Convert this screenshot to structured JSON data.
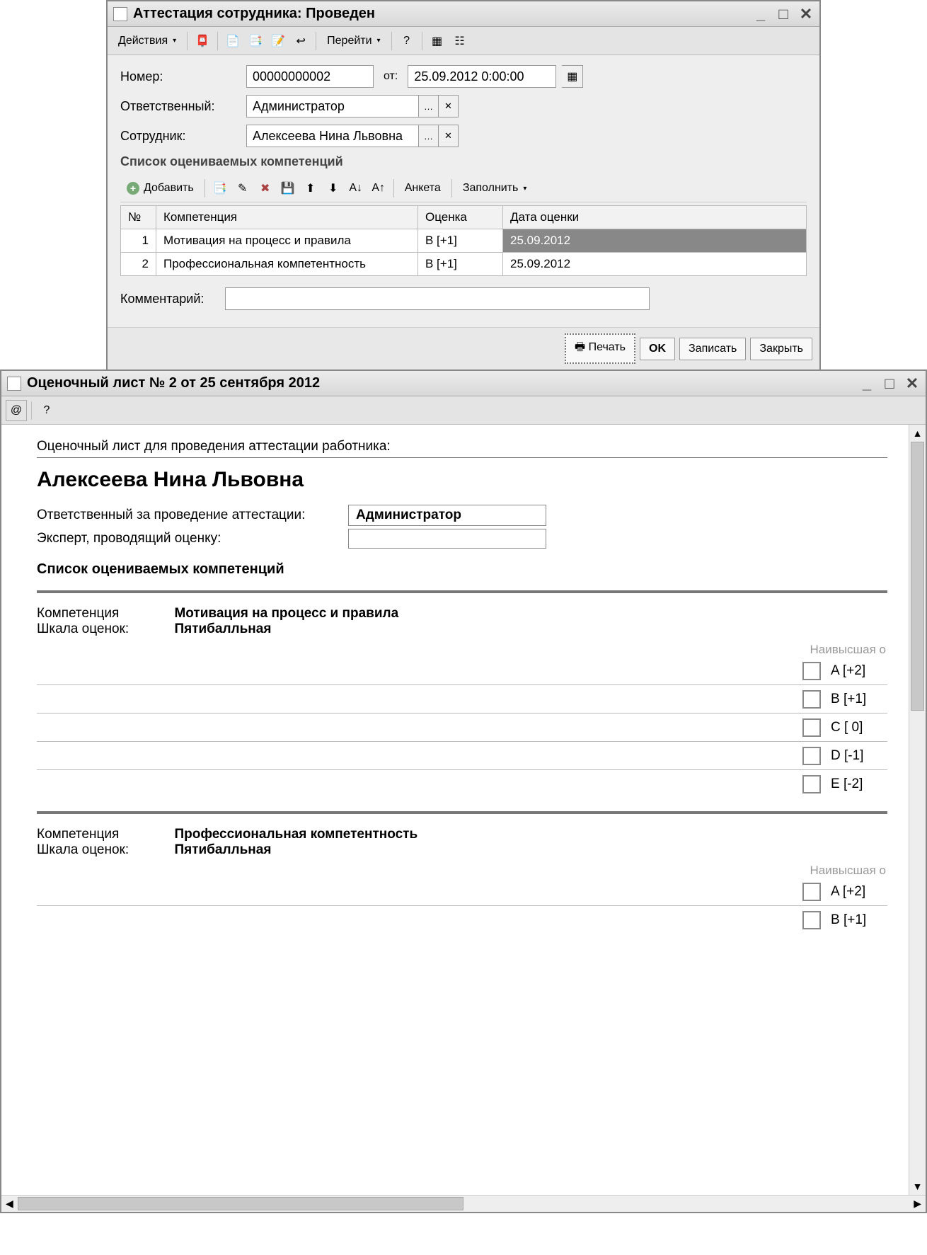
{
  "window1": {
    "title": "Аттестация сотрудника: Проведен",
    "toolbar": {
      "actions": "Действия",
      "goto": "Перейти"
    },
    "fields": {
      "number_label": "Номер:",
      "number_value": "00000000002",
      "from_label": "от:",
      "date_value": "25.09.2012  0:00:00",
      "responsible_label": "Ответственный:",
      "responsible_value": "Администратор",
      "employee_label": "Сотрудник:",
      "employee_value": "Алексеева Нина Львовна",
      "comment_label": "Комментарий:",
      "comment_value": ""
    },
    "competencies": {
      "section": "Список оцениваемых компетенций",
      "add": "Добавить",
      "anketa": "Анкета",
      "fill": "Заполнить",
      "columns": {
        "num": "№",
        "comp": "Компетенция",
        "grade": "Оценка",
        "date": "Дата оценки"
      },
      "rows": [
        {
          "n": "1",
          "comp": "Мотивация на процесс и правила",
          "grade": "B [+1]",
          "date": "25.09.2012"
        },
        {
          "n": "2",
          "comp": "Профессиональная компетентность",
          "grade": "B [+1]",
          "date": "25.09.2012"
        }
      ]
    },
    "footer": {
      "print": "Печать",
      "ok": "OK",
      "save": "Записать",
      "close": "Закрыть"
    }
  },
  "window2": {
    "title": "Оценочный лист № 2 от 25 сентября 2012",
    "doc": {
      "heading": "Оценочный лист для проведения аттестации работника:",
      "employee": "Алексеева Нина Львовна",
      "resp_label": "Ответственный за проведение аттестации:",
      "resp_value": "Администратор",
      "expert_label": "Эксперт, проводящий оценку:",
      "expert_value": "",
      "list_title": "Список оцениваемых компетенций",
      "comp_label": "Компетенция",
      "scale_label": "Шкала оценок:",
      "hint": "Наивысшая о",
      "blocks": [
        {
          "name": "Мотивация на процесс и правила",
          "scale": "Пятибалльная",
          "options": [
            "A [+2]",
            "B [+1]",
            "C [ 0]",
            "D [-1]",
            "E [-2]"
          ]
        },
        {
          "name": "Профессиональная компетентность",
          "scale": "Пятибалльная",
          "options": [
            "A [+2]",
            "B [+1]"
          ]
        }
      ]
    }
  }
}
